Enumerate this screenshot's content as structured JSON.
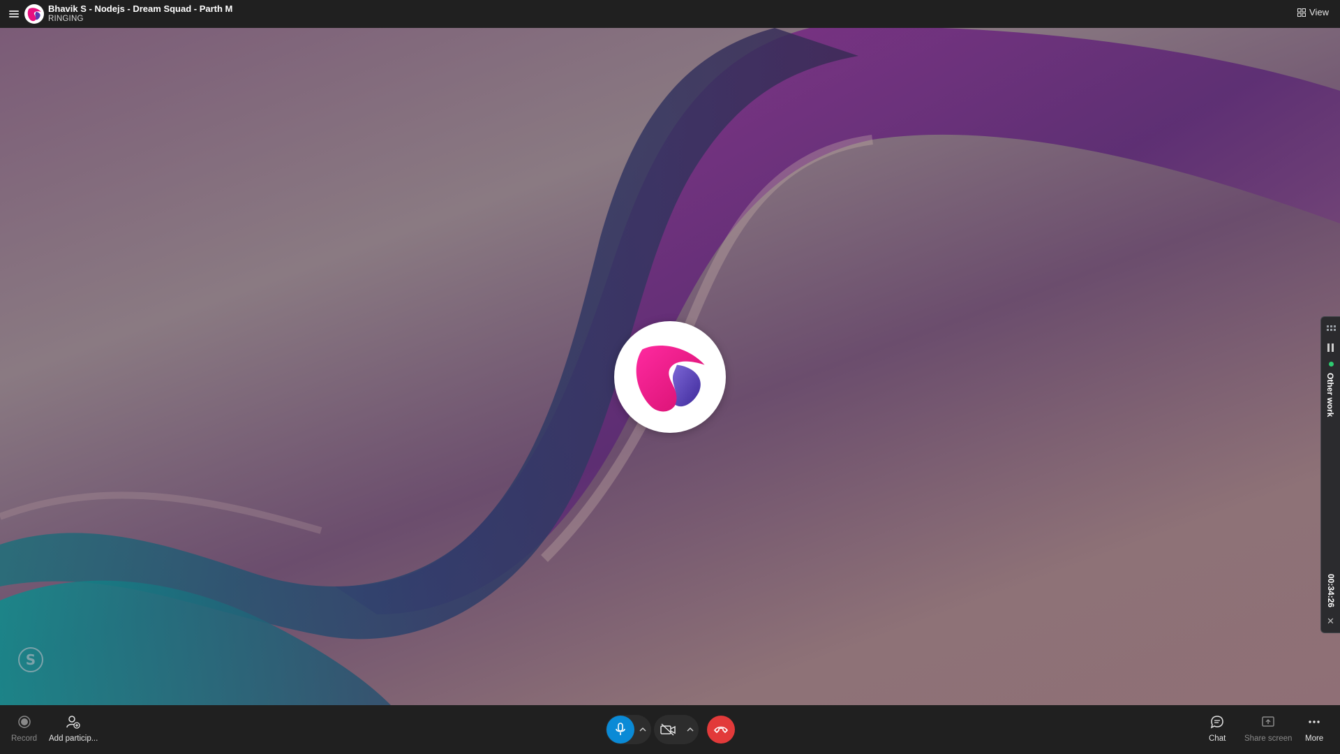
{
  "header": {
    "call_title": "Bhavik S - Nodejs - Dream Squad - Parth M",
    "call_status": "RINGING",
    "view_label": "View"
  },
  "side_widget": {
    "label": "Other work",
    "timer": "00:34:26"
  },
  "toolbar": {
    "record_label": "Record",
    "add_participants_label": "Add particip...",
    "chat_label": "Chat",
    "share_screen_label": "Share screen",
    "more_label": "More"
  },
  "colors": {
    "accent_blue": "#0a8ad6",
    "end_call_red": "#e23a3a",
    "status_green": "#2ecc71",
    "logo_pink": "#e8107f",
    "logo_purple": "#5a3ab0"
  },
  "icons": {
    "menu": "hamburger-icon",
    "view": "grid-icon",
    "record": "record-icon",
    "add_participant": "add-person-icon",
    "mic": "microphone-icon",
    "camera": "camera-off-icon",
    "end_call": "hang-up-icon",
    "chat": "chat-bubble-icon",
    "share": "share-screen-icon",
    "more": "ellipsis-icon"
  }
}
